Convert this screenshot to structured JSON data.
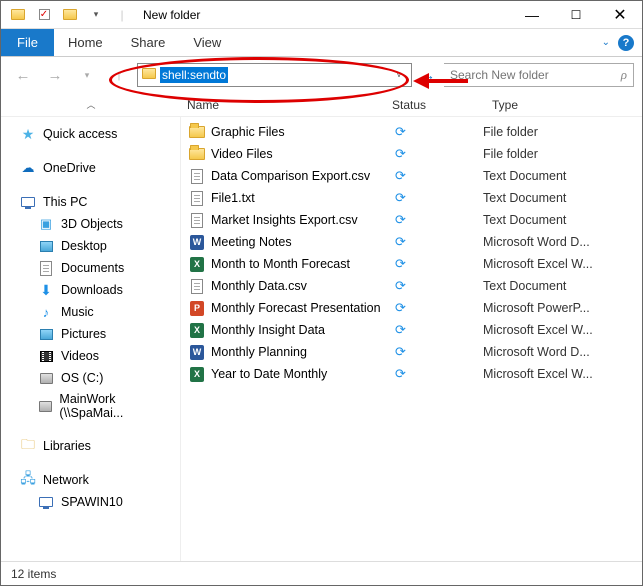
{
  "titlebar": {
    "title": "New folder"
  },
  "ribbon": {
    "file": "File",
    "tabs": [
      "Home",
      "Share",
      "View"
    ]
  },
  "address": {
    "value": "shell:sendto",
    "selected": true
  },
  "search": {
    "placeholder": "Search New folder"
  },
  "columns": {
    "name": "Name",
    "status": "Status",
    "type": "Type"
  },
  "nav": {
    "quick_access": "Quick access",
    "onedrive": "OneDrive",
    "this_pc": "This PC",
    "pc_children": [
      {
        "label": "3D Objects",
        "icon": "3d"
      },
      {
        "label": "Desktop",
        "icon": "pic"
      },
      {
        "label": "Documents",
        "icon": "doc"
      },
      {
        "label": "Downloads",
        "icon": "dl"
      },
      {
        "label": "Music",
        "icon": "music"
      },
      {
        "label": "Pictures",
        "icon": "pic"
      },
      {
        "label": "Videos",
        "icon": "vid"
      },
      {
        "label": "OS (C:)",
        "icon": "disk"
      },
      {
        "label": "MainWork (\\\\SpaMai...",
        "icon": "disk"
      }
    ],
    "libraries": "Libraries",
    "network": "Network",
    "net_children": [
      {
        "label": "SPAWIN10",
        "icon": "pc"
      }
    ]
  },
  "files": [
    {
      "name": "Graphic Files",
      "icon": "folder",
      "type": "File folder"
    },
    {
      "name": "Video Files",
      "icon": "folder",
      "type": "File folder"
    },
    {
      "name": "Data Comparison Export.csv",
      "icon": "doc",
      "type": "Text Document"
    },
    {
      "name": "File1.txt",
      "icon": "doc",
      "type": "Text Document"
    },
    {
      "name": "Market Insights Export.csv",
      "icon": "doc",
      "type": "Text Document"
    },
    {
      "name": "Meeting Notes",
      "icon": "word",
      "type": "Microsoft Word D..."
    },
    {
      "name": "Month to Month Forecast",
      "icon": "excel",
      "type": "Microsoft Excel W..."
    },
    {
      "name": "Monthly Data.csv",
      "icon": "doc",
      "type": "Text Document"
    },
    {
      "name": "Monthly Forecast Presentation",
      "icon": "ppt",
      "type": "Microsoft PowerP..."
    },
    {
      "name": "Monthly Insight Data",
      "icon": "excel",
      "type": "Microsoft Excel W..."
    },
    {
      "name": "Monthly Planning",
      "icon": "word",
      "type": "Microsoft Word D..."
    },
    {
      "name": "Year to Date Monthly",
      "icon": "excel",
      "type": "Microsoft Excel W..."
    }
  ],
  "status": {
    "item_count": "12 items"
  }
}
